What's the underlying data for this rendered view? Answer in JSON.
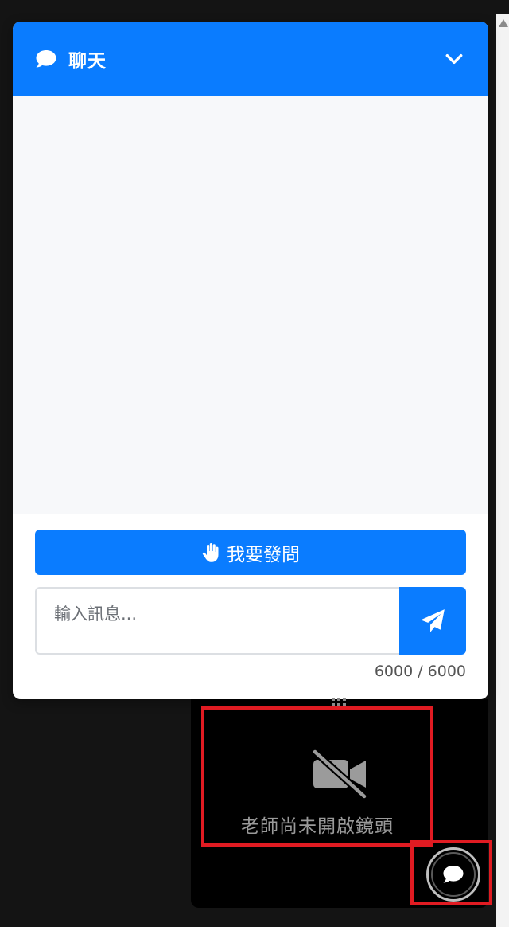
{
  "chat": {
    "title": "聊天",
    "raise_hand_label": "我要發問",
    "input_placeholder": "輸入訊息...",
    "char_counter": "6000 / 6000"
  },
  "video": {
    "camera_off_text": "老師尚未開啟鏡頭"
  },
  "colors": {
    "accent": "#0a7cff",
    "highlight": "#e01b22"
  },
  "icons": {
    "header": "chat-bubble-icon",
    "collapse": "chevron-down-icon",
    "raise_hand": "hand-icon",
    "send": "paper-plane-icon",
    "camera_off": "video-slash-icon",
    "fab": "chat-bubble-icon"
  }
}
